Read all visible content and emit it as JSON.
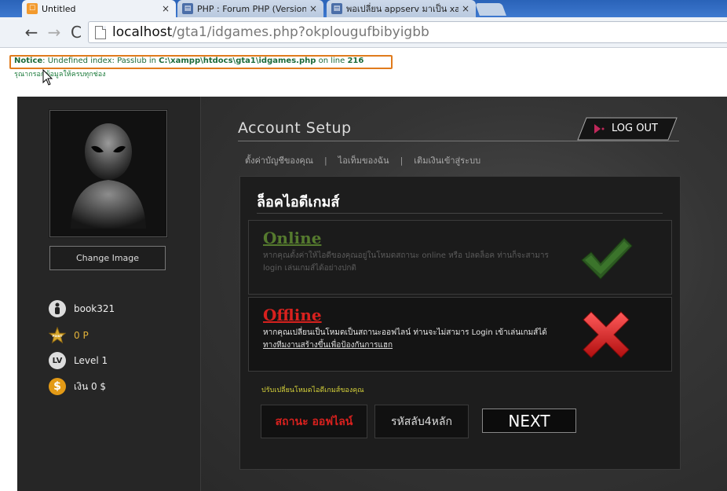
{
  "browser": {
    "tabs": [
      {
        "title": "Untitled",
        "icon": "page-favicon"
      },
      {
        "title": "PHP : Forum PHP (Version 3.",
        "icon": "forum-favicon"
      },
      {
        "title": "พอเปลี่ยน appserv มาเป็น xa",
        "icon": "forum-favicon"
      }
    ],
    "close_glyph": "×",
    "address": {
      "host": "localhost",
      "path": "/gta1/idgames.php?okplougufbibyigbb"
    }
  },
  "php_notice": {
    "label": "Notice",
    "text": ": Undefined index: Passlub in ",
    "file": "C:\\xampp\\htdocs\\gta1\\idgames.php",
    "on_line": " on line ",
    "line": "216"
  },
  "fill_message": "รุณากรอกข้อมูลให้ครบทุกช่อง",
  "profile": {
    "change_image": "Change Image",
    "username": "book321",
    "points": "0 P",
    "level": "Level 1",
    "money": "เงิน 0 $",
    "icons": [
      "person-icon",
      "star-icon",
      "level-icon",
      "dollar-icon"
    ],
    "level_badge": "LV",
    "dollar_badge": "$",
    "star_badge": "POINT"
  },
  "header": {
    "title": "Account Setup",
    "logout": "LOG OUT",
    "menu": [
      "ตั้งค่าบัญชีของคุณ",
      "ไอเท็มของฉัน",
      "เติมเงินเข้าสู่ระบบ"
    ],
    "separator": "|"
  },
  "panel": {
    "title": "ล็อคไอดีเกมส์",
    "online": {
      "heading": "Online",
      "description": "หากคุณตั้งค่าให้ไอดีของคุณอยู่ในโหมดสถานะ online หรือ ปลดล็อค ท่านก็จะสามาร login เล่นเกมส์ได้อย่างปกติ"
    },
    "offline": {
      "heading": "Offline",
      "description": "หากคุณเปลี่ยนเป็นโหมดเป็นสถานะออฟไลน์ ท่านจะไม่สามาร Login เข้าเล่นเกมส์ได้ ",
      "link": "ทางทีมงานสร้างขึ้นเพื่อป้องกันการแฮก"
    },
    "switch_label": "ปรับเปลี่ยนโหมดไอดีเกมส์ของคุณ",
    "status_button": "สถานะ ออฟไลน์",
    "pin_button": "รหัสลับ4หลัก",
    "next_button": "NEXT"
  },
  "colors": {
    "online_green": "#557a2e",
    "offline_red": "#d8211e",
    "notice_orange": "#e07b1c"
  }
}
